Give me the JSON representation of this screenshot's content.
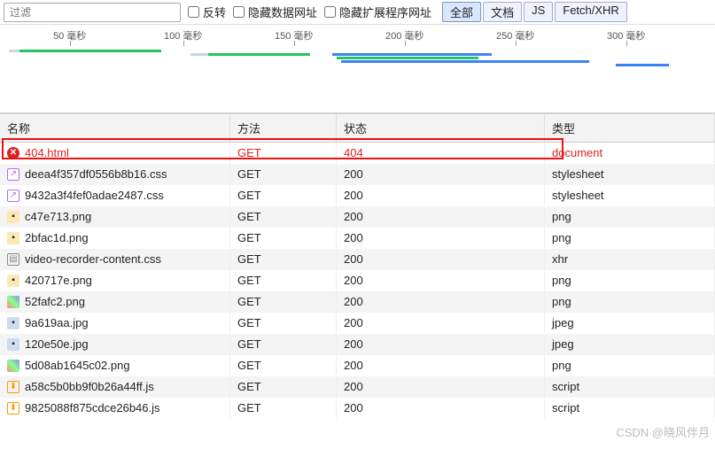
{
  "toolbar": {
    "filter_placeholder": "过滤",
    "invert": "反转",
    "hide_data_urls": "隐藏数据网址",
    "hide_ext_urls": "隐藏扩展程序网址",
    "tabs": {
      "all": "全部",
      "doc": "文档",
      "js": "JS",
      "fetch": "Fetch/XHR"
    }
  },
  "timeline": {
    "ticks": [
      "50 毫秒",
      "100 毫秒",
      "150 毫秒",
      "200 毫秒",
      "250 毫秒",
      "300 毫秒"
    ]
  },
  "headers": {
    "name": "名称",
    "method": "方法",
    "status": "状态",
    "type": "类型"
  },
  "rows": [
    {
      "icon": "err",
      "name": "404.html",
      "method": "GET",
      "status": "404",
      "type": "document",
      "err": true
    },
    {
      "icon": "css",
      "name": "deea4f357df0556b8b16.css",
      "method": "GET",
      "status": "200",
      "type": "stylesheet"
    },
    {
      "icon": "css",
      "name": "9432a3f4fef0adae2487.css",
      "method": "GET",
      "status": "200",
      "type": "stylesheet"
    },
    {
      "icon": "png",
      "name": "c47e713.png",
      "method": "GET",
      "status": "200",
      "type": "png"
    },
    {
      "icon": "png",
      "name": "2bfac1d.png",
      "method": "GET",
      "status": "200",
      "type": "png"
    },
    {
      "icon": "doc",
      "name": "video-recorder-content.css",
      "method": "GET",
      "status": "200",
      "type": "xhr"
    },
    {
      "icon": "png",
      "name": "420717e.png",
      "method": "GET",
      "status": "200",
      "type": "png"
    },
    {
      "icon": "img",
      "name": "52fafc2.png",
      "method": "GET",
      "status": "200",
      "type": "png"
    },
    {
      "icon": "jpg",
      "name": "9a619aa.jpg",
      "method": "GET",
      "status": "200",
      "type": "jpeg"
    },
    {
      "icon": "jpg",
      "name": "120e50e.jpg",
      "method": "GET",
      "status": "200",
      "type": "jpeg"
    },
    {
      "icon": "img",
      "name": "5d08ab1645c02.png",
      "method": "GET",
      "status": "200",
      "type": "png"
    },
    {
      "icon": "js",
      "name": "a58c5b0bb9f0b26a44ff.js",
      "method": "GET",
      "status": "200",
      "type": "script"
    },
    {
      "icon": "js",
      "name": "9825088f875cdce26b46.js",
      "method": "GET",
      "status": "200",
      "type": "script"
    }
  ],
  "watermark": "CSDN @晓风伴月"
}
